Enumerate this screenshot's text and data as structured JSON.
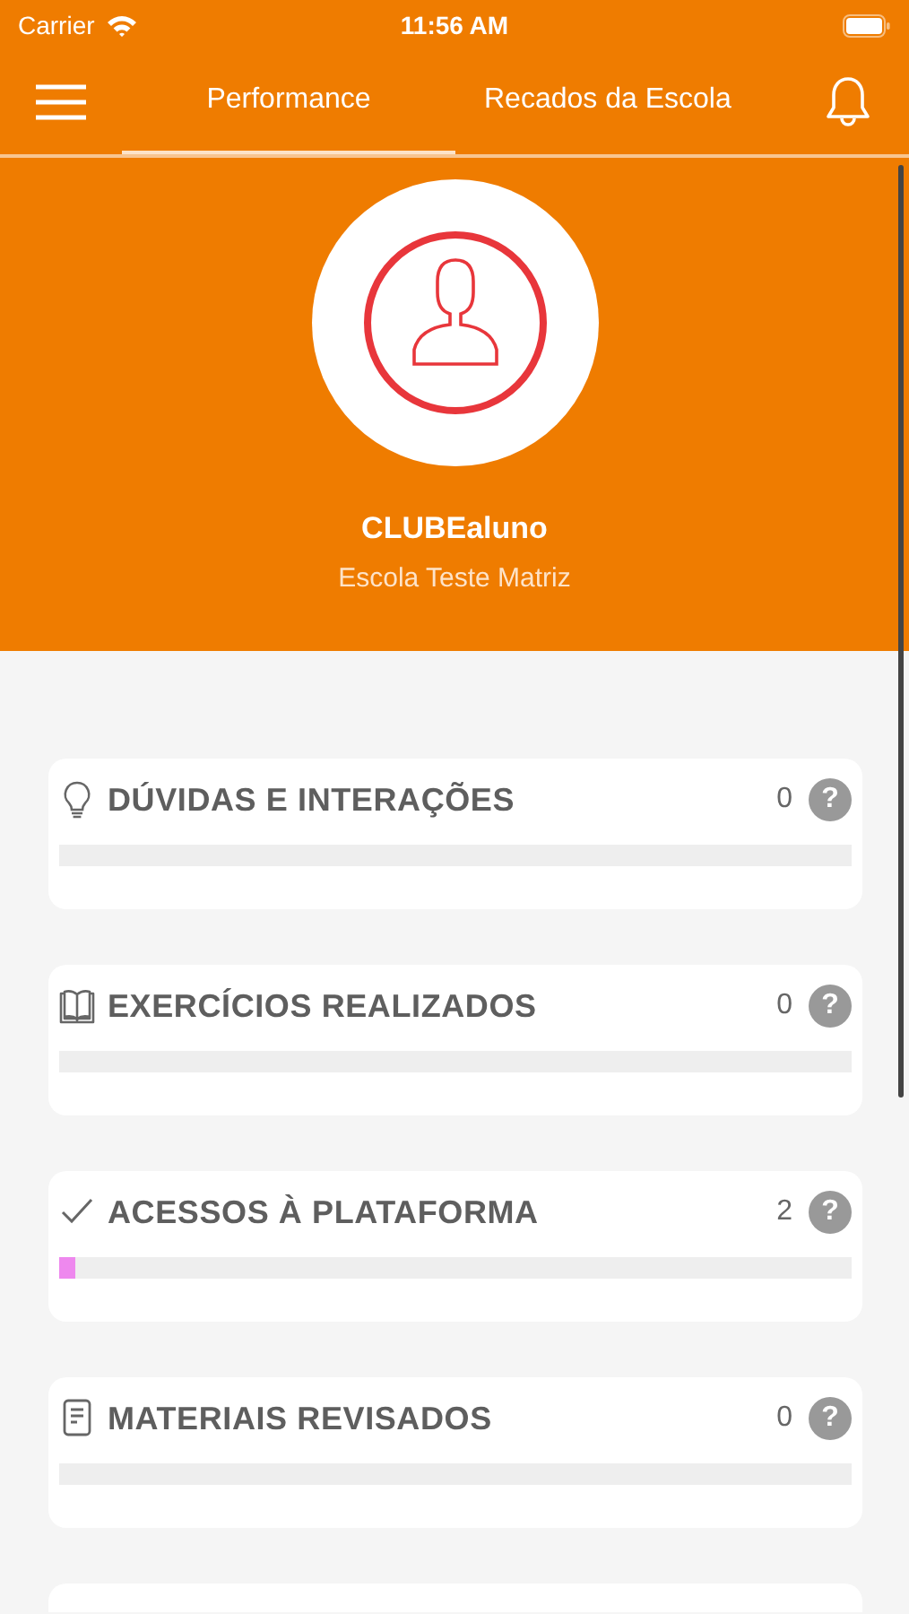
{
  "status_bar": {
    "carrier": "Carrier",
    "time": "11:56 AM"
  },
  "tabs": [
    {
      "label": "Performance",
      "selected": true
    },
    {
      "label": "Recados da Escola",
      "selected": false
    }
  ],
  "profile": {
    "name": "CLUBEaluno",
    "school": "Escola Teste Matriz"
  },
  "cards": [
    {
      "kind": "bulb",
      "title": "DÚVIDAS E INTERAÇÕES",
      "count": "0",
      "help": "?",
      "level": 0
    },
    {
      "kind": "book",
      "title": "EXERCÍCIOS REALIZADOS",
      "count": "0",
      "help": "?",
      "level": 0
    },
    {
      "kind": "check",
      "title": "ACESSOS À PLATAFORMA",
      "count": "2",
      "help": "?",
      "level": 0.02,
      "color": "#ee88ee"
    },
    {
      "kind": "document",
      "title": "MATERIAIS REVISADOS",
      "count": "0",
      "help": "?",
      "level": 0
    }
  ]
}
